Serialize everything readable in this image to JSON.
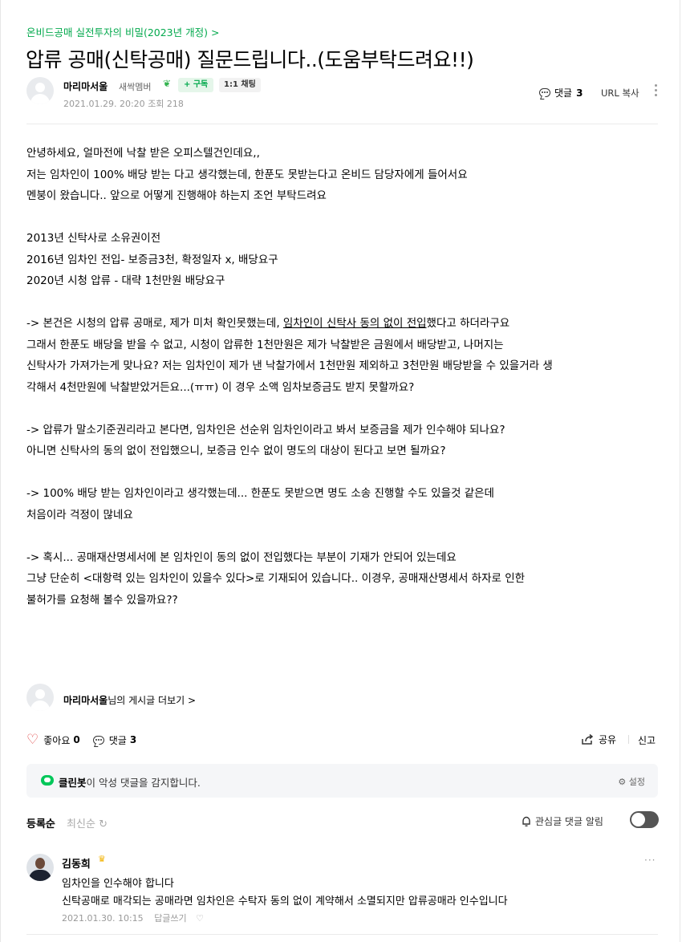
{
  "cafe_link": "온비드공매 실전투자의 비밀(2023년 개정) >",
  "title": "압류 공매(신탁공매) 질문드립니다..(도움부탁드려요!!)",
  "author": {
    "name": "마리마서울",
    "grade": "새싹멤버",
    "subscribe": "+ 구독",
    "chat": "1:1 채팅",
    "date": "2021.01.29. 20:20",
    "views": "조회 218"
  },
  "header_actions": {
    "comment_label": "댓글",
    "comment_count": "3",
    "url_copy": "URL 복사"
  },
  "body": {
    "l1": "안녕하세요, 얼마전에 낙찰 받은 오피스텔건인데요,,",
    "l2": "저는 임차인이 100% 배당 받는 다고 생각했는데, 한푼도 못받는다고 온비드 담당자에게 들어서요",
    "l3": "멘붕이 왔습니다..  앞으로 어떻게 진행해야 하는지 조언 부탁드려요",
    "l4": "2013년 신탁사로 소유권이전",
    "l5": "2016년 임차인 전입- 보증금3천, 확정일자 x,   배당요구",
    "l6": "2020년 시청 압류 - 대략 1천만원 배당요구",
    "l7a": "-> 본건은 시청의 압류 공매로, 제가 미처 확인못했는데, ",
    "l7u": "임차인이 신탁사 동의 없이 전입",
    "l7b": "했다고 하더라구요",
    "l8": "그래서 한푼도 배당을 받을 수 없고, 시청이 압류한 1천만원은 제가 낙찰받은 금원에서 배당받고, 나머지는",
    "l9": "신탁사가 가져가는게 맞나요? 저는 임차인이 제가 낸 낙찰가에서 1천만원 제외하고 3천만원 배당받을 수 있을거라 생",
    "l10": "각해서 4천만원에 낙찰받았거든요...(ㅠㅠ) 이 경우 소액 임차보증금도 받지 못할까요?",
    "l11": "-> 압류가 말소기준권리라고 본다면, 임차인은 선순위 임차인이라고 봐서  보증금을 제가 인수해야 되나요?",
    "l12": "아니면 신탁사의 동의 없이 전입했으니, 보증금 인수 없이 명도의 대상이 된다고 보면 될까요?",
    "l13": "-> 100% 배당 받는 임차인이라고 생각했는데... 한푼도 못받으면 명도 소송 진행할 수도 있을것 같은데",
    "l14": "처음이라 걱정이 많네요",
    "l15": "-> 혹시... 공매재산명세서에 본 임차인이 동의 없이 전입했다는 부분이 기재가 안되어 있는데요",
    "l16": "그냥 단순히 <대항력 있는 임차인이 있을수 있다>로 기재되어 있습니다..  이경우, 공매재산명세서 하자로 인한",
    "l17": "불허가를 요청해 볼수 있을까요??"
  },
  "more_posts": {
    "name": "마리마서울",
    "suffix": "님의 게시글 더보기 >"
  },
  "actions": {
    "like_label": "좋아요",
    "like_count": "0",
    "comment_label": "댓글",
    "comment_count": "3",
    "share": "공유",
    "report": "신고"
  },
  "cleanbot": {
    "name": "클린봇",
    "text": "이 악성 댓글을 감지합니다.",
    "settings": "설정"
  },
  "sort": {
    "active": "등록순",
    "inactive": "최신순",
    "alarm": "관심글 댓글 알림"
  },
  "comment": {
    "author": "김동희",
    "line1": "임차인을 인수해야 합니다",
    "line2": "신탁공매로 매각되는 공매라면 임차인은 수탁자 동의 없이 계약해서 소멸되지만 압류공매라 인수입니다",
    "date": "2021.01.30. 10:15",
    "reply": "답글쓰기"
  },
  "colors": {
    "brand_green": "#03a94d",
    "heart_red": "#e04c4c"
  }
}
